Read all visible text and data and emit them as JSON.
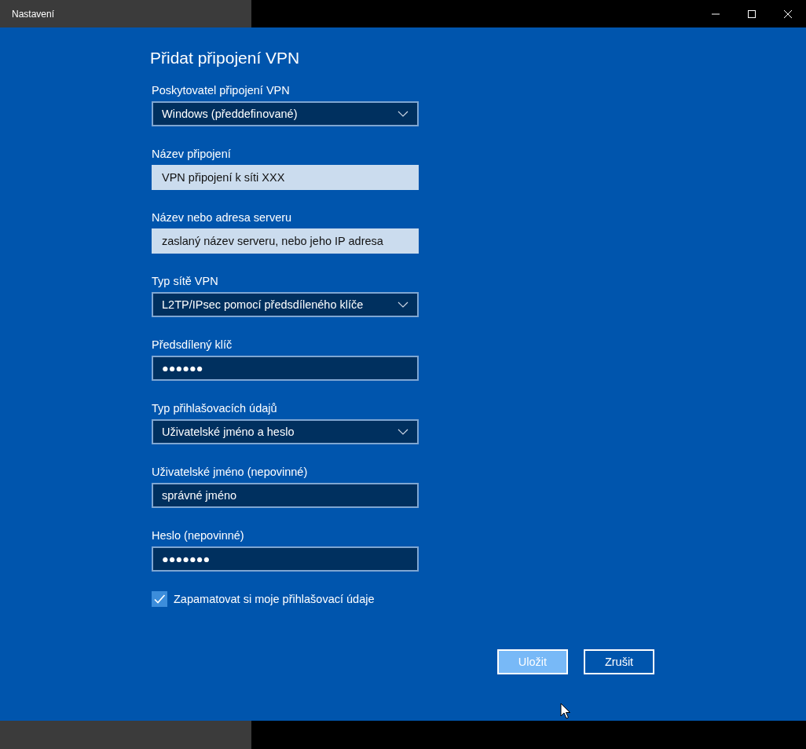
{
  "window": {
    "title": "Nastavení"
  },
  "heading": "Přidat připojení VPN",
  "fields": [
    {
      "label": "Poskytovatel připojení VPN",
      "kind": "dropdown",
      "value": "Windows (předdefinované)"
    },
    {
      "label": "Název připojení",
      "kind": "highlighted",
      "value": "VPN připojení k síti XXX"
    },
    {
      "label": "Název nebo adresa serveru",
      "kind": "highlighted",
      "value": "zaslaný název serveru, nebo jeho IP adresa"
    },
    {
      "label": "Typ sítě VPN",
      "kind": "dropdown",
      "value": "L2TP/IPsec pomocí předsdíleného klíče"
    },
    {
      "label": "Předsdílený klíč",
      "kind": "input",
      "value": "●●●●●●"
    },
    {
      "label": "Typ přihlašovacích údajů",
      "kind": "dropdown",
      "value": "Uživatelské jméno a heslo"
    },
    {
      "label": "Uživatelské jméno (nepovinné)",
      "kind": "input",
      "value": "správné jméno"
    },
    {
      "label": "Heslo (nepovinné)",
      "kind": "input",
      "value": "●●●●●●●"
    }
  ],
  "remember": {
    "label": "Zapamatovat si moje přihlašovací údaje",
    "checked": true
  },
  "buttons": [
    {
      "label": "Uložit",
      "hovered": true
    },
    {
      "label": "Zrušit",
      "hovered": false
    }
  ]
}
